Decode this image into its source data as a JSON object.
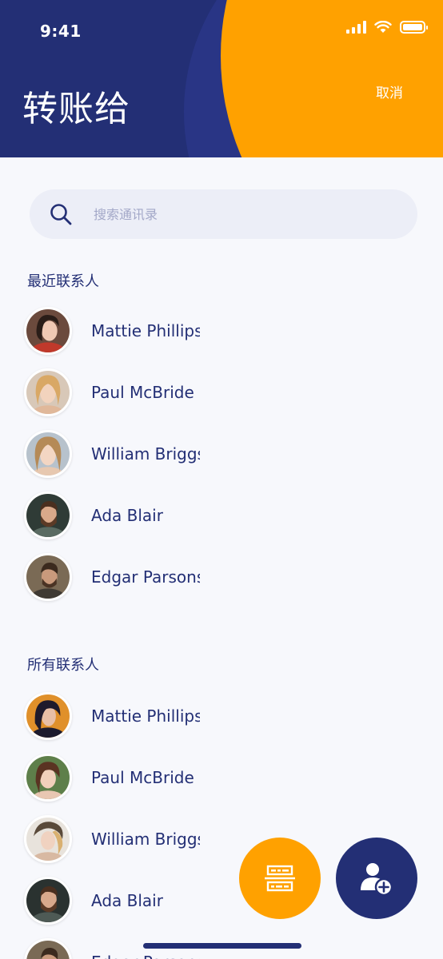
{
  "status_bar": {
    "time": "9:41"
  },
  "header": {
    "title": "转账给",
    "cancel_label": "取消"
  },
  "search": {
    "placeholder": "搜索通讯录"
  },
  "recent": {
    "title": "最近联系人",
    "contacts": [
      {
        "name": "Mattie Phillips"
      },
      {
        "name": "Paul McBride"
      },
      {
        "name": "William Briggs"
      },
      {
        "name": "Ada Blair"
      },
      {
        "name": "Edgar Parsons"
      }
    ]
  },
  "all": {
    "title": "所有联系人",
    "contacts": [
      {
        "name": "Mattie Phillips"
      },
      {
        "name": "Paul McBride"
      },
      {
        "name": "William Briggs"
      },
      {
        "name": "Ada Blair"
      },
      {
        "name": "Edgar Parsons"
      }
    ]
  },
  "colors": {
    "primary": "#232f75",
    "accent": "#ffa100",
    "background": "#f7f8fc"
  },
  "icons": {
    "scan": "scan-icon",
    "add_contact": "add-contact-icon"
  }
}
